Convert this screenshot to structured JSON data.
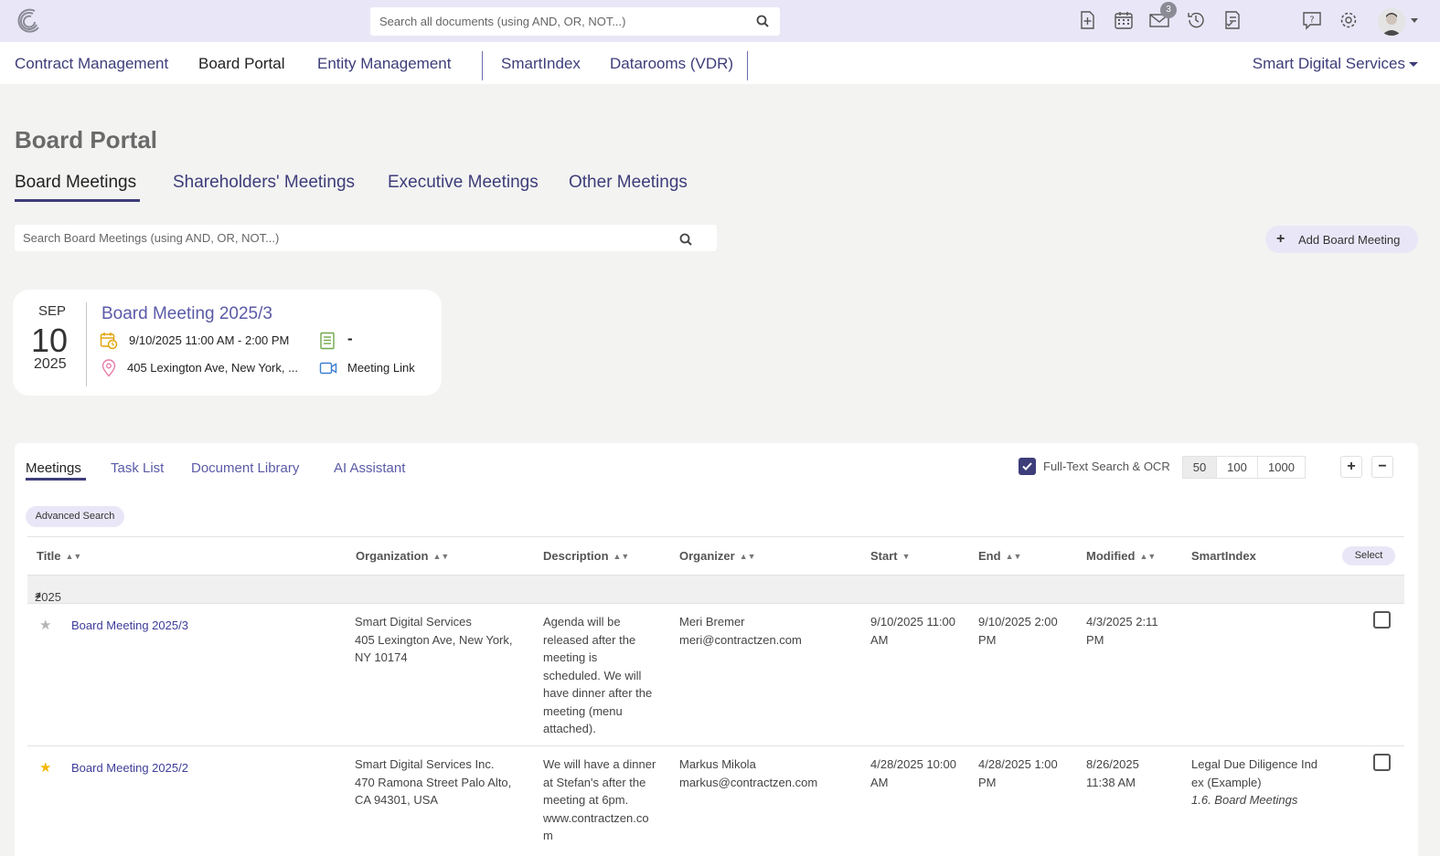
{
  "header": {
    "search_placeholder": "Search all documents (using AND, OR, NOT...)",
    "notification_count": "3",
    "icons": [
      "new-document-icon",
      "calendar-icon",
      "mail-icon",
      "history-icon",
      "task-list-icon",
      "help-icon",
      "gear-icon",
      "avatar"
    ]
  },
  "nav": {
    "items": [
      "Contract Management",
      "Board Portal",
      "Entity Management",
      "SmartIndex",
      "Datarooms (VDR)"
    ],
    "active": "Board Portal",
    "organization": "Smart Digital Services"
  },
  "page": {
    "title": "Board Portal",
    "tabs": [
      "Board Meetings",
      "Shareholders' Meetings",
      "Executive Meetings",
      "Other Meetings"
    ],
    "active_tab": "Board Meetings",
    "search_placeholder": "Search Board Meetings (using AND, OR, NOT...)",
    "add_button": "Add Board Meeting"
  },
  "card": {
    "month": "SEP",
    "day": "10",
    "year": "2025",
    "title": "Board Meeting 2025/3",
    "datetime": "9/10/2025 11:00 AM - 2:00 PM",
    "document": "-",
    "location": "405 Lexington Ave, New York, ...",
    "meeting_link": "Meeting Link"
  },
  "panel": {
    "tabs": [
      "Meetings",
      "Task List",
      "Document Library",
      "AI Assistant"
    ],
    "active_tab": "Meetings",
    "fulltext_label": "Full-Text Search & OCR",
    "fulltext_checked": true,
    "page_sizes": [
      "50",
      "100",
      "1000"
    ],
    "page_size_selected": "50",
    "expand_label": "+",
    "collapse_label": "−",
    "advanced_search": "Advanced Search",
    "select_button": "Select",
    "columns": [
      "Title",
      "Organization",
      "Description",
      "Organizer",
      "Start",
      "End",
      "Modified",
      "SmartIndex"
    ],
    "group_label": "2025",
    "rows": [
      {
        "starred": false,
        "title": "Board Meeting 2025/3",
        "organization": "Smart Digital Services\n405 Lexington Ave, New York,\nNY 10174",
        "description": "Agenda will be\nreleased after the\nmeeting is\nscheduled. We will\nhave dinner after the\nmeeting (menu\nattached).",
        "organizer": "Meri Bremer\nmeri@contractzen.com",
        "start": "9/10/2025 11:00\nAM",
        "end": "9/10/2025 2:00\nPM",
        "modified": "4/3/2025 2:11\nPM",
        "smartindex": "",
        "smartindex_sub": ""
      },
      {
        "starred": true,
        "title": "Board Meeting 2025/2",
        "organization": "Smart Digital Services Inc.\n470 Ramona Street Palo Alto,\nCA 94301, USA",
        "description": "We will have a dinner\nat Stefan's after the\nmeeting at 6pm.\nwww.contractzen.co\nm",
        "organizer": "Markus Mikola\nmarkus@contractzen.com",
        "start": "4/28/2025 10:00\nAM",
        "end": "4/28/2025 1:00\nPM",
        "modified": "8/26/2025\n11:38 AM",
        "smartindex": "Legal Due Diligence Ind\nex (Example)",
        "smartindex_sub": "1.6. Board Meetings"
      }
    ]
  },
  "colors": {
    "topbar": "#e9e7f7",
    "accent": "#3d3d7a",
    "link": "#5a5aa8",
    "star_active": "#f5b800",
    "star_inactive": "#b5b5b5"
  }
}
